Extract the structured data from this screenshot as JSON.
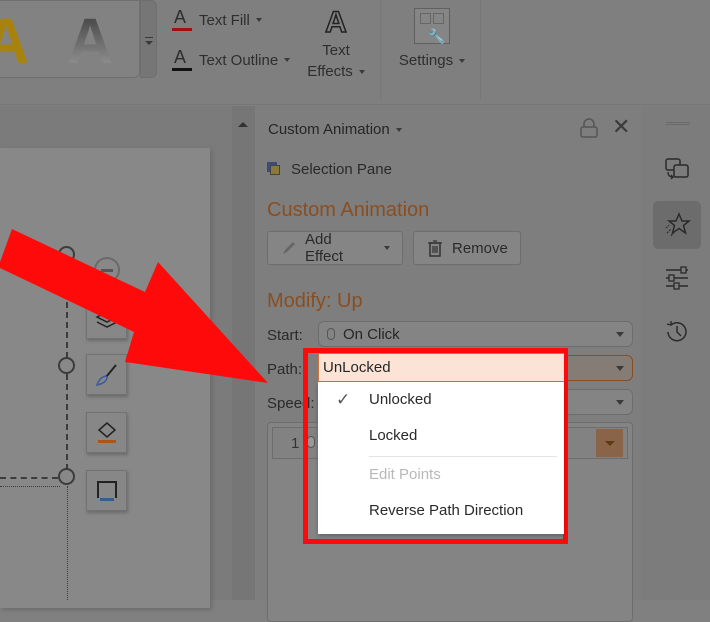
{
  "ribbon": {
    "gallery": {
      "letter_gold": "A",
      "letter_gradient": "A"
    },
    "text_fill": "Text Fill",
    "text_outline": "Text Outline",
    "text_effects_line1": "Text",
    "text_effects_line2": "Effects",
    "settings": "Settings",
    "icon_letter": "A"
  },
  "panel": {
    "title": "Custom Animation",
    "selection_pane": "Selection Pane",
    "section_title": "Custom Animation",
    "add_effect": "Add Effect",
    "remove": "Remove",
    "modify_title": "Modify: Up",
    "start_label": "Start:",
    "start_value": "On Click",
    "path_label": "Path:",
    "path_value": "UnLocked",
    "speed_label": "Speed:",
    "list_items": [
      {
        "number": "1"
      }
    ]
  },
  "path_menu": {
    "current": "UnLocked",
    "items": [
      {
        "label": "Unlocked",
        "checked": true,
        "enabled": true
      },
      {
        "label": "Locked",
        "checked": false,
        "enabled": true
      },
      {
        "label": "Edit Points",
        "checked": false,
        "enabled": false
      },
      {
        "label": "Reverse Path Direction",
        "checked": false,
        "enabled": true
      }
    ],
    "check_glyph": "✓"
  },
  "sidebar": {
    "items": [
      "switch-windows",
      "custom-animation",
      "adjustments",
      "history"
    ],
    "active": "custom-animation"
  },
  "annotation": {
    "color": "#ff0a0a"
  },
  "colors": {
    "accent": "#8a4e20",
    "path_highlight": "#fbe4d5"
  }
}
